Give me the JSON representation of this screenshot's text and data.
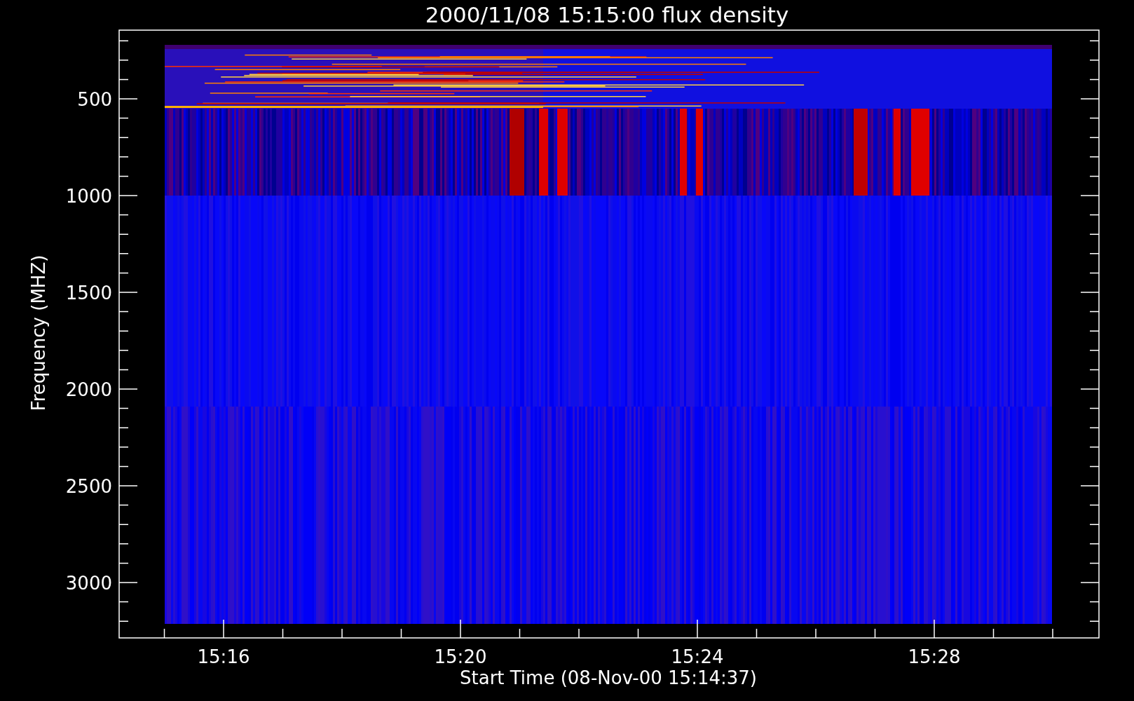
{
  "title": "2000/11/08 15:15:00 flux density",
  "xaxis": {
    "label": "Start Time (08-Nov-00 15:14:37)",
    "ticks": [
      "15:16",
      "15:20",
      "15:24",
      "15:28"
    ]
  },
  "yaxis": {
    "label": "Frequency (MHZ)",
    "ticks": [
      "500",
      "1000",
      "1500",
      "2000",
      "2500",
      "3000"
    ]
  }
}
